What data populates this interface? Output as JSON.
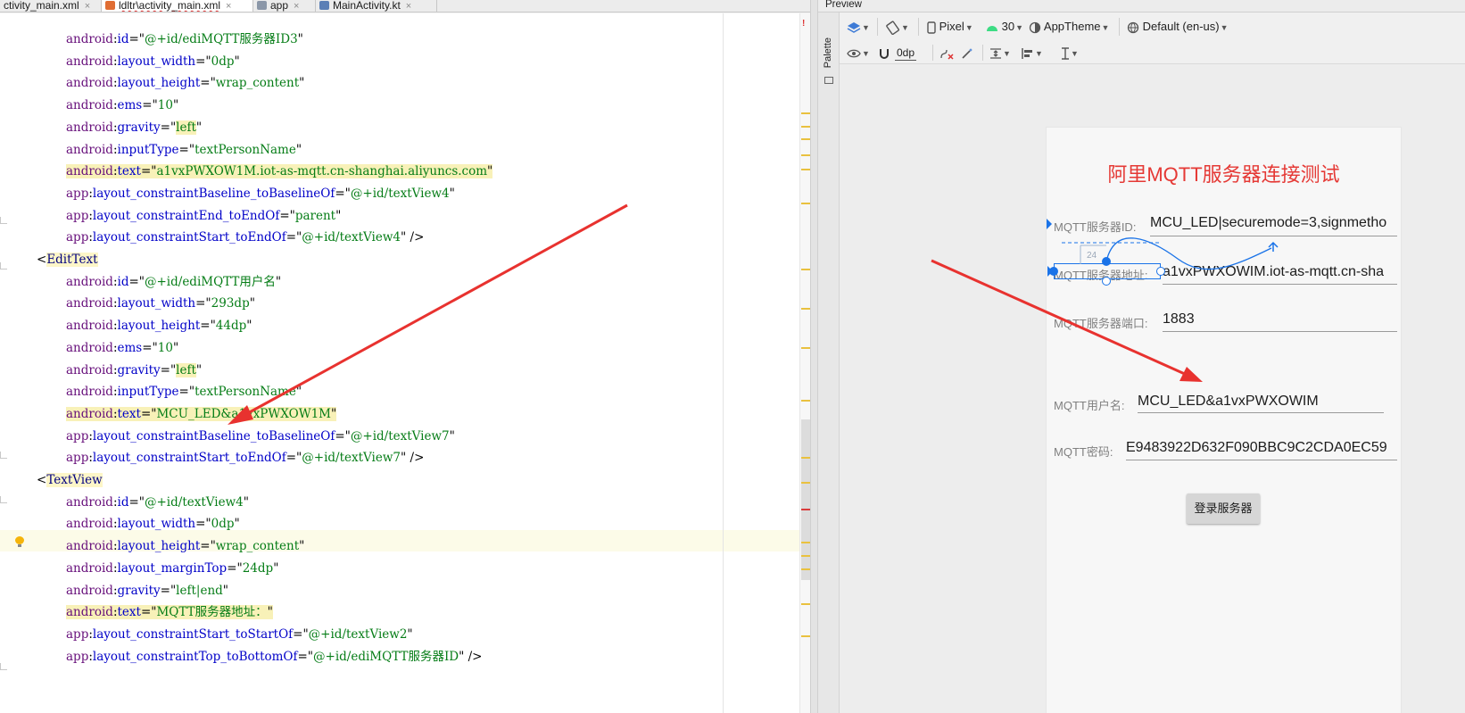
{
  "tabs": [
    {
      "label": "ctivity_main.xml",
      "close": "×"
    },
    {
      "label": "ldltr\\activity_main.xml",
      "close": "×"
    },
    {
      "label": "app",
      "close": "×"
    },
    {
      "label": "MainActivity.kt",
      "close": "×"
    }
  ],
  "editor": {
    "stripe_error": "!",
    "lines": [
      {
        "ns": "android",
        "attr": "id",
        "value": "@+id/ediMQTT服务器ID3"
      },
      {
        "ns": "android",
        "attr": "layout_width",
        "value": "0dp"
      },
      {
        "ns": "android",
        "attr": "layout_height",
        "value": "wrap_content"
      },
      {
        "ns": "android",
        "attr": "ems",
        "value": "10"
      },
      {
        "ns": "android",
        "attr": "gravity",
        "value": "left"
      },
      {
        "ns": "android",
        "attr": "inputType",
        "value": "textPersonName"
      },
      {
        "ns": "android",
        "attr": "text",
        "value": "a1vxPWXOW1M.iot-as-mqtt.cn-shanghai.aliyuncs.com"
      },
      {
        "ns": "app",
        "attr": "layout_constraintBaseline_toBaselineOf",
        "value": "@+id/textView4"
      },
      {
        "ns": "app",
        "attr": "layout_constraintEnd_toEndOf",
        "value": "parent"
      },
      {
        "ns": "app",
        "attr": "layout_constraintStart_toEndOf",
        "value": "@+id/textView4",
        "tail": " />"
      },
      {
        "tag": "EditText"
      },
      {
        "ns": "android",
        "attr": "id",
        "value": "@+id/ediMQTT用户名"
      },
      {
        "ns": "android",
        "attr": "layout_width",
        "value": "293dp"
      },
      {
        "ns": "android",
        "attr": "layout_height",
        "value": "44dp"
      },
      {
        "ns": "android",
        "attr": "ems",
        "value": "10"
      },
      {
        "ns": "android",
        "attr": "gravity",
        "value": "left"
      },
      {
        "ns": "android",
        "attr": "inputType",
        "value": "textPersonName"
      },
      {
        "ns": "android",
        "attr": "text",
        "value": "MCU_LED&a1vxPWXOW1M"
      },
      {
        "ns": "app",
        "attr": "layout_constraintBaseline_toBaselineOf",
        "value": "@+id/textView7"
      },
      {
        "ns": "app",
        "attr": "layout_constraintStart_toEndOf",
        "value": "@+id/textView7",
        "tail": " />"
      },
      {
        "tag": "TextView"
      },
      {
        "ns": "android",
        "attr": "id",
        "value": "@+id/textView4"
      },
      {
        "ns": "android",
        "attr": "layout_width",
        "value": "0dp"
      },
      {
        "ns": "android",
        "attr": "layout_height",
        "value": "wrap_content"
      },
      {
        "ns": "android",
        "attr": "layout_marginTop",
        "value": "24dp"
      },
      {
        "ns": "android",
        "attr": "gravity",
        "value": "left|end"
      },
      {
        "ns": "android",
        "attr": "text",
        "value": "MQTT服务器地址："
      },
      {
        "ns": "app",
        "attr": "layout_constraintStart_toStartOf",
        "value": "@+id/textView2"
      },
      {
        "ns": "app",
        "attr": "layout_constraintTop_toBottomOf",
        "value": "@+id/ediMQTT服务器ID",
        "tail": " />"
      }
    ]
  },
  "preview": {
    "header": "Preview",
    "palette": "Palette",
    "toolbar": {
      "device": "Pixel",
      "api": "30",
      "theme": "AppTheme",
      "locale": "Default (en-us)",
      "margin": "0dp"
    }
  },
  "app": {
    "title": "阿里MQTT服务器连接测试",
    "fields": [
      {
        "label": "MQTT服务器ID:",
        "value": "MCU_LED|securemode=3,signmetho"
      },
      {
        "label": "MQTT服务器地址:",
        "value": "a1vxPWXOWIM.iot-as-mqtt.cn-sha"
      },
      {
        "label": "MQTT服务器端口:",
        "value": "1883"
      },
      {
        "label": "MQTT用户名:",
        "value": "MCU_LED&a1vxPWXOWIM"
      },
      {
        "label": "MQTT密码:",
        "value": "E9483922D632F090BBC9C2CDA0EC59"
      }
    ],
    "login_button": "登录服务器",
    "margin_label": "24"
  },
  "colors": {
    "title_red": "#e53935",
    "selection_blue": "#1a73e8",
    "annotation_arrow": "#e8322f"
  }
}
